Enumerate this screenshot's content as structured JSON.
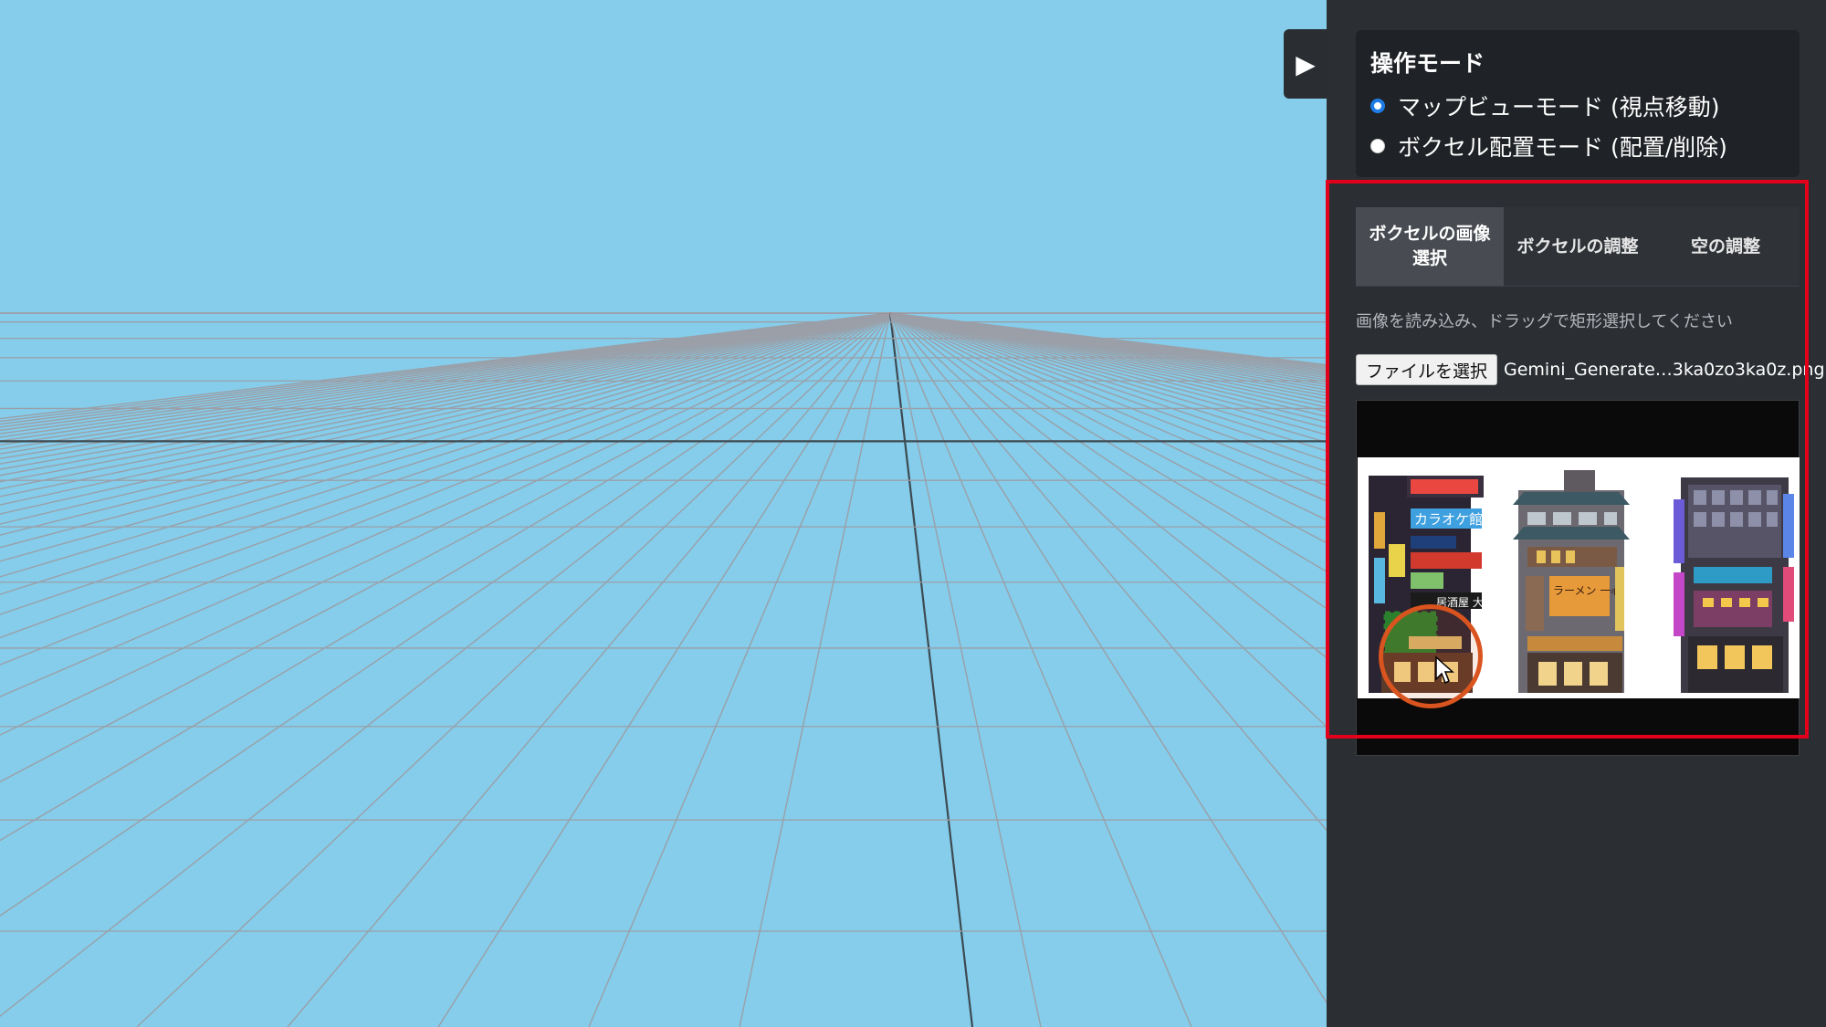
{
  "toggle": {
    "icon": "play-icon",
    "glyph": "▶"
  },
  "mode_panel": {
    "title": "操作モード",
    "options": [
      {
        "label": "マップビューモード (視点移動)",
        "checked": true
      },
      {
        "label": "ボクセル配置モード (配置/削除)",
        "checked": false
      }
    ]
  },
  "tabs": [
    {
      "label": "ボクセルの画像\n選択",
      "active": true
    },
    {
      "label": "ボクセルの調整",
      "active": false
    },
    {
      "label": "空の調整",
      "active": false
    }
  ],
  "image_select": {
    "hint": "画像を読み込み、ドラッグで矩形選択してください",
    "file_button": "ファイルを選択",
    "file_name": "Gemini_Generate…3ka0zo3ka0z.png",
    "preview_signs": [
      "カラオケ館",
      "居酒屋 大和",
      "ラーメン 一心"
    ]
  },
  "colors": {
    "sky": "#85CDEA",
    "panel": "#2B2E33",
    "highlight": "#E3001B",
    "selection": "#2BCB2B",
    "cursor_ring": "#D9541E"
  }
}
